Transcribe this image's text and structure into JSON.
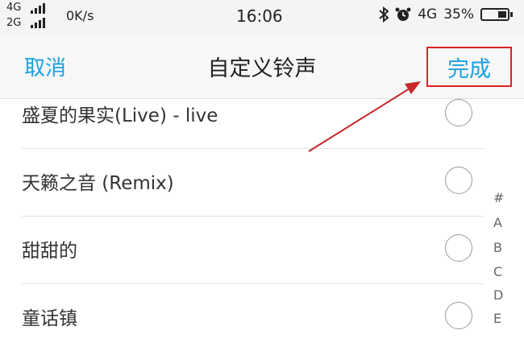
{
  "status_bar": {
    "network_1": "4G",
    "network_2": "2G",
    "speed": "0K/s",
    "time": "16:06",
    "network_right": "4G",
    "battery_text": "35%",
    "battery_level": 0.35
  },
  "nav": {
    "cancel_label": "取消",
    "title": "自定义铃声",
    "done_label": "完成"
  },
  "songs": [
    {
      "title": "盛夏的果实(Live) - live"
    },
    {
      "title": "天籁之音 (Remix)"
    },
    {
      "title": "甜甜的"
    },
    {
      "title": "童话镇"
    }
  ],
  "index_letters": [
    "#",
    "A",
    "B",
    "C",
    "D",
    "E"
  ],
  "colors": {
    "accent": "#1ba1e2",
    "highlight": "#d22222"
  },
  "icons": [
    "bluetooth-icon",
    "alarm-icon",
    "battery-icon",
    "signal-icon"
  ]
}
